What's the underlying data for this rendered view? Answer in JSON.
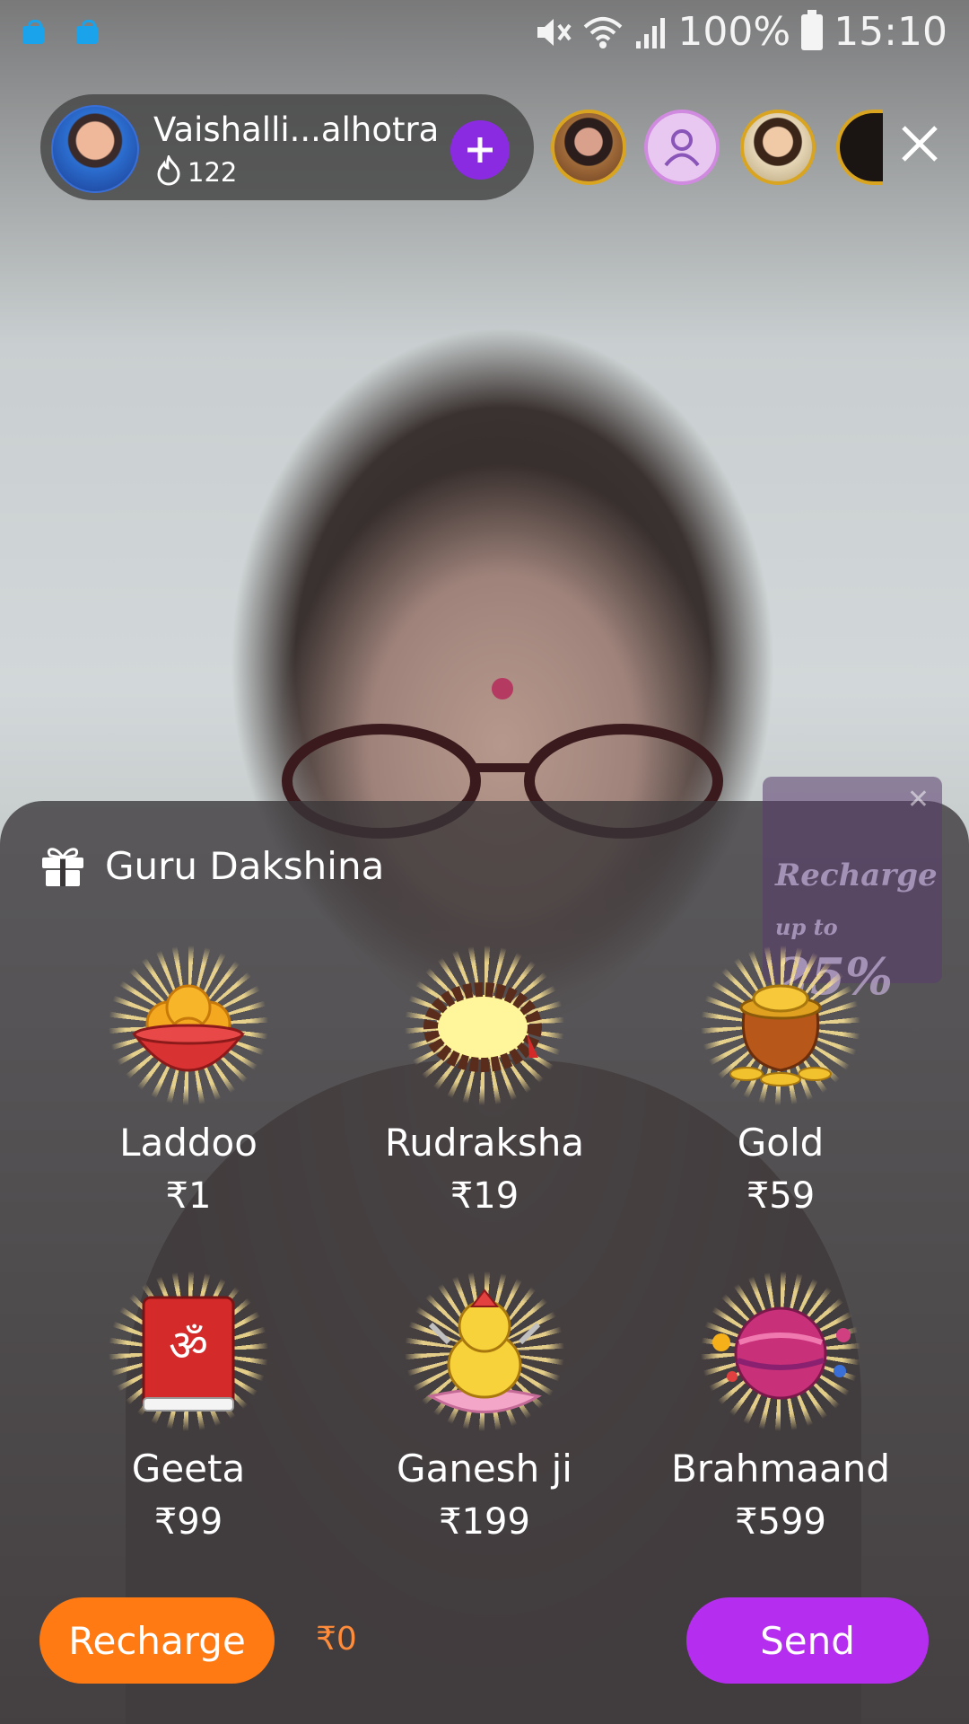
{
  "status_bar": {
    "battery": "100%",
    "time": "15:10",
    "icons": [
      "shopping-bag-icon",
      "shopping-bag-icon",
      "mute-icon",
      "wifi-icon",
      "signal-icon",
      "battery-icon"
    ]
  },
  "host": {
    "name": "Vaishalli...alhotra",
    "count": "122",
    "icon": "fire-icon"
  },
  "gift_panel": {
    "title": "Guru Dakshina",
    "promo": {
      "line1": "Recharge",
      "prefix": "up to",
      "percent": "25%"
    },
    "gifts": [
      {
        "name": "Laddoo",
        "price": "₹1"
      },
      {
        "name": "Rudraksha",
        "price": "₹19"
      },
      {
        "name": "Gold",
        "price": "₹59"
      },
      {
        "name": "Geeta",
        "price": "₹99"
      },
      {
        "name": "Ganesh ji",
        "price": "₹199"
      },
      {
        "name": "Brahmaand",
        "price": "₹599"
      }
    ]
  },
  "footer": {
    "recharge_label": "Recharge",
    "balance": "₹0",
    "send_label": "Send"
  },
  "colors": {
    "recharge": "#ff7a12",
    "send": "#b52ef0",
    "follow": "#8a2be2",
    "balance_text": "#ff8c3a"
  }
}
